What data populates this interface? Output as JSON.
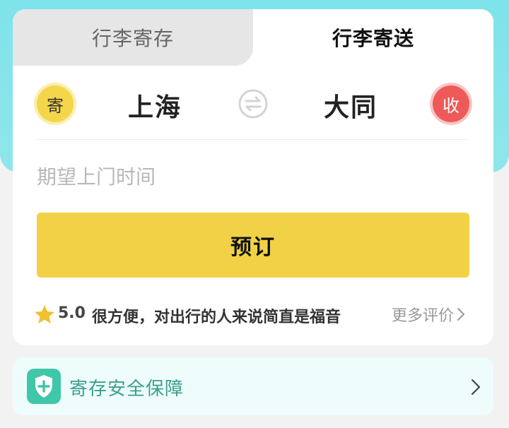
{
  "tabs": [
    {
      "label": "行李寄存",
      "active": false
    },
    {
      "label": "行李寄送",
      "active": true
    }
  ],
  "route": {
    "send_badge": "寄",
    "from_city": "上海",
    "to_city": "大同",
    "recv_badge": "收"
  },
  "time_input": {
    "placeholder": "期望上门时间",
    "value": ""
  },
  "book_button": {
    "label": "预订"
  },
  "review": {
    "rating": "5.0",
    "text": "很方便，对出行的人来说简直是福音",
    "more_label": "更多评价"
  },
  "safety": {
    "label": "寄存安全保障"
  },
  "colors": {
    "teal": "#7ee3ea",
    "accent_yellow": "#f1d246",
    "receive_red": "#ee5a5a",
    "safety_green": "#3aa08e"
  },
  "icons": {
    "swap": "swap-icon",
    "star": "star-icon",
    "shield": "shield-plus-icon",
    "chevron": "chevron-right-icon"
  }
}
